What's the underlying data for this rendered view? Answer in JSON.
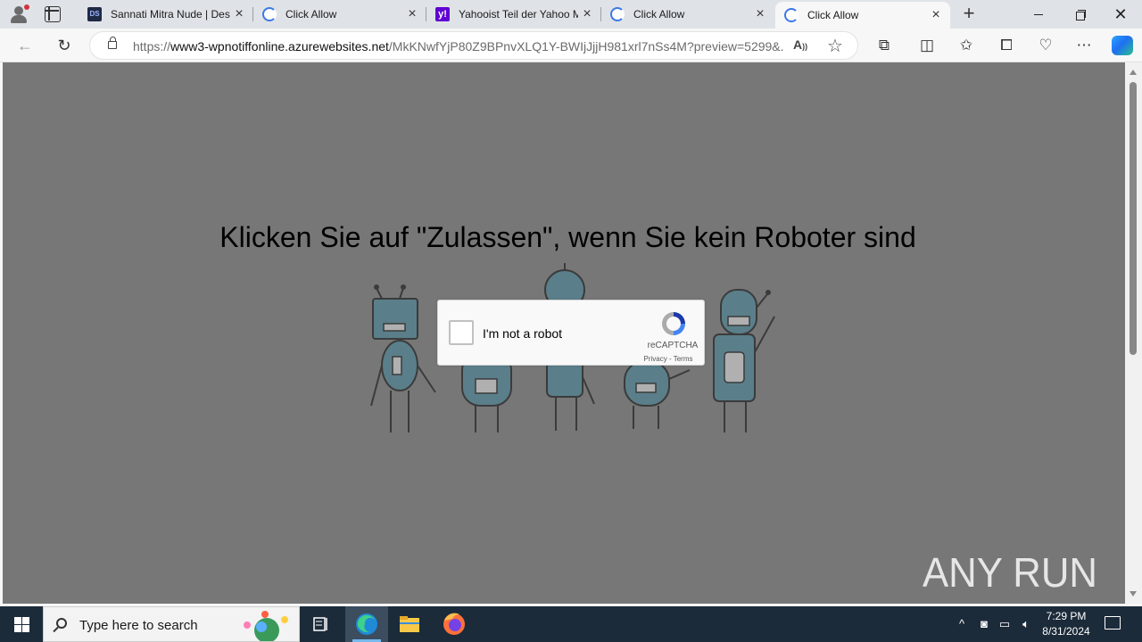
{
  "browser": {
    "tabs": [
      {
        "title": "Sannati Mitra Nude | Des",
        "favicon": "ds-icon",
        "active": false
      },
      {
        "title": "Click Allow",
        "favicon": "loading-icon",
        "active": false
      },
      {
        "title": "Yahooist Teil der Yahoo M",
        "favicon": "yahoo-icon",
        "active": false
      },
      {
        "title": "Click Allow",
        "favicon": "loading-icon",
        "active": false
      },
      {
        "title": "Click Allow",
        "favicon": "loading-icon",
        "active": true
      }
    ],
    "url": {
      "scheme": "https://",
      "host": "www3-wpnotiffonline.azurewebsites.net",
      "path": "/MkKNwfYjP80Z9BPnvXLQ1Y-BWIjJjjH981xrl7nSs4M?preview=5299&..."
    }
  },
  "page": {
    "headline": "Klicken Sie auf \"Zulassen\", wenn Sie kein Roboter sind",
    "captcha": {
      "label": "I'm not a robot",
      "brand": "reCAPTCHA",
      "privacy": "Privacy",
      "separator": " - ",
      "terms": "Terms"
    },
    "watermark": "ANY RUN"
  },
  "taskbar": {
    "search_placeholder": "Type here to search",
    "time": "7:29 PM",
    "date": "8/31/2024"
  },
  "colors": {
    "page_overlay": "#777777",
    "taskbar": "#1c2b3a",
    "accent": "#1a73e8"
  }
}
